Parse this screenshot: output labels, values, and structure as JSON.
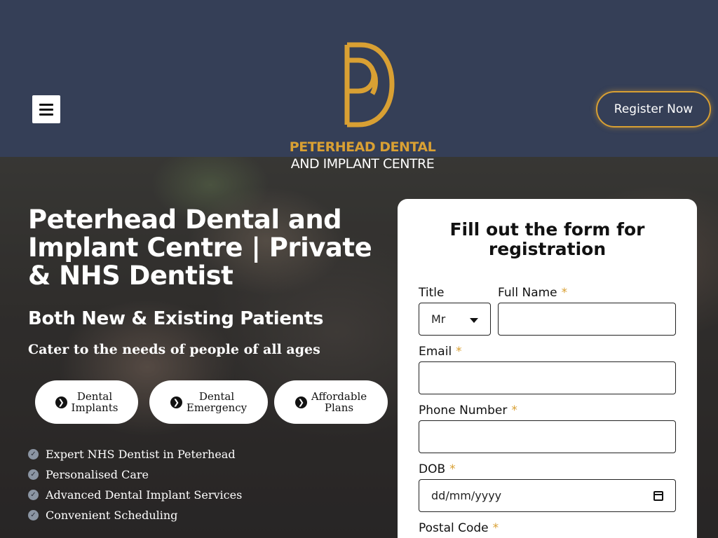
{
  "header": {
    "logo_line1": "PETERHEAD DENTAL",
    "logo_line2": "AND IMPLANT CENTRE",
    "register_label": "Register Now",
    "icons": {
      "menu": "hamburger-menu-icon",
      "logo": "pd-monogram-logo"
    }
  },
  "hero": {
    "title": "Peterhead Dental and Implant Centre | Private & NHS Dentist",
    "subtitle": "Both New & Existing Patients",
    "tagline": "Cater to the needs of people of all ages",
    "buttons": [
      {
        "label": "Dental\nImplants"
      },
      {
        "label": "Dental\nEmergency"
      },
      {
        "label": "Affordable\nPlans"
      }
    ],
    "features": [
      "Expert NHS Dentist in Peterhead",
      "Personalised Care",
      "Advanced Dental Implant Services",
      "Convenient Scheduling"
    ]
  },
  "form": {
    "title": "Fill out the form for registration",
    "fields": {
      "title": {
        "label": "Title",
        "value": "Mr"
      },
      "full_name": {
        "label": "Full Name",
        "required": "*",
        "value": ""
      },
      "email": {
        "label": "Email",
        "required": "*",
        "value": ""
      },
      "phone": {
        "label": "Phone Number",
        "required": "*",
        "value": ""
      },
      "dob": {
        "label": "DOB",
        "required": "*",
        "placeholder": "dd/mm/yyyy"
      },
      "postal_code": {
        "label": "Postal Code",
        "required": "*"
      }
    }
  },
  "colors": {
    "header_bg": "#353f57",
    "accent_gold": "#d9a033",
    "card_bg": "#ffffff"
  }
}
